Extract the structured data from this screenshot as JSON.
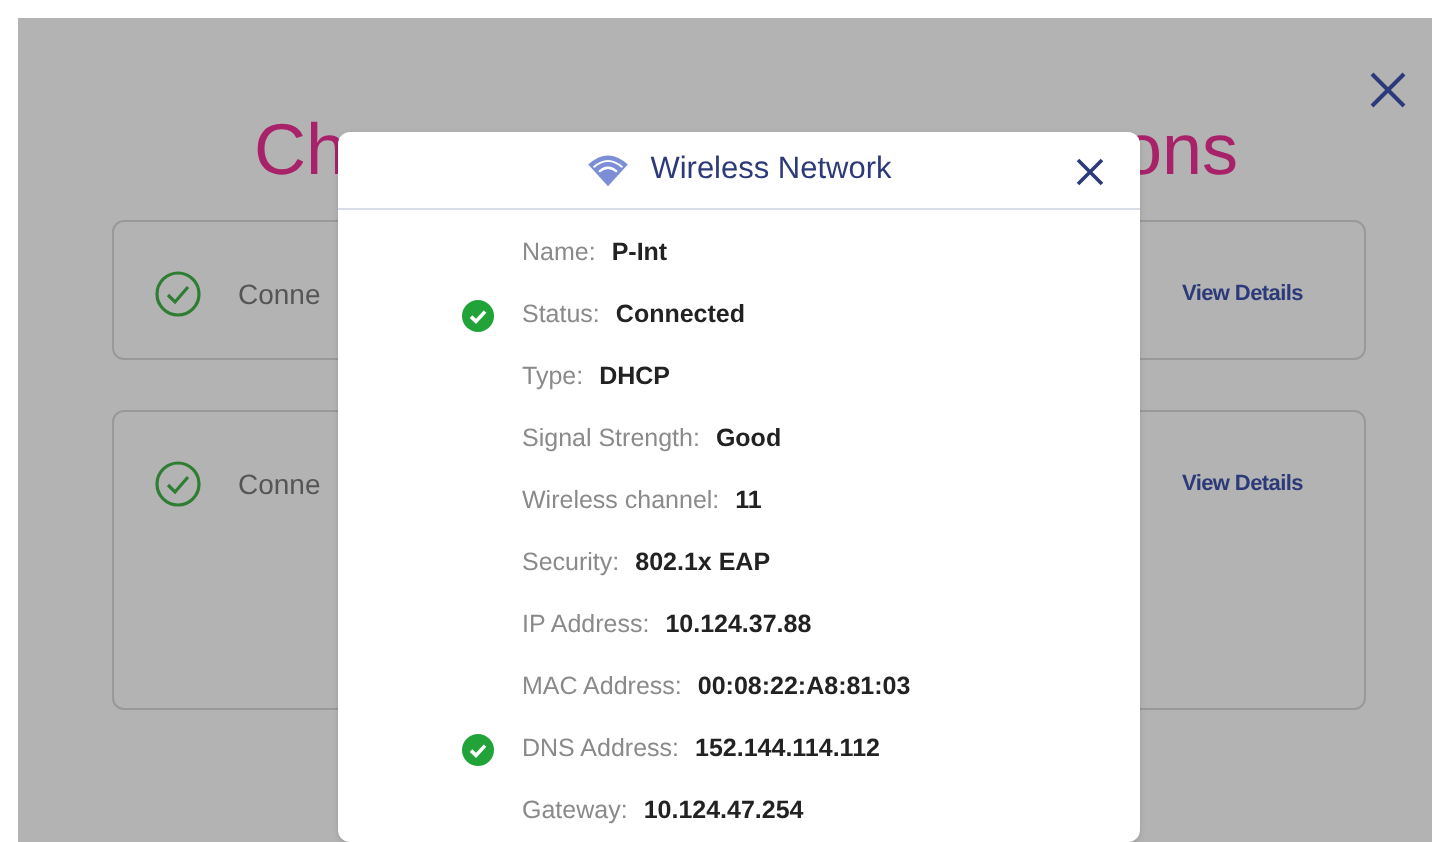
{
  "background": {
    "title_left": "Ch",
    "title_right": "ons",
    "cards": [
      {
        "label": "Conne",
        "link": "View Details",
        "checked": true
      },
      {
        "label": "Conne",
        "link": "View Details",
        "checked": true
      }
    ]
  },
  "dialog": {
    "title": "Wireless Network",
    "rows": [
      {
        "label": "Name:",
        "value": "P-Int",
        "ok": false
      },
      {
        "label": "Status:",
        "value": "Connected",
        "ok": true
      },
      {
        "label": "Type:",
        "value": "DHCP",
        "ok": false
      },
      {
        "label": "Signal Strength:",
        "value": "Good",
        "ok": false
      },
      {
        "label": "Wireless channel:",
        "value": "11",
        "ok": false
      },
      {
        "label": "Security:",
        "value": "802.1x EAP",
        "ok": false
      },
      {
        "label": "IP Address:",
        "value": "10.124.37.88",
        "ok": false
      },
      {
        "label": "MAC Address:",
        "value": "00:08:22:A8:81:03",
        "ok": false
      },
      {
        "label": "DNS Address:",
        "value": "152.144.114.112",
        "ok": true
      },
      {
        "label": "Gateway:",
        "value": "10.124.47.254",
        "ok": false
      }
    ]
  }
}
